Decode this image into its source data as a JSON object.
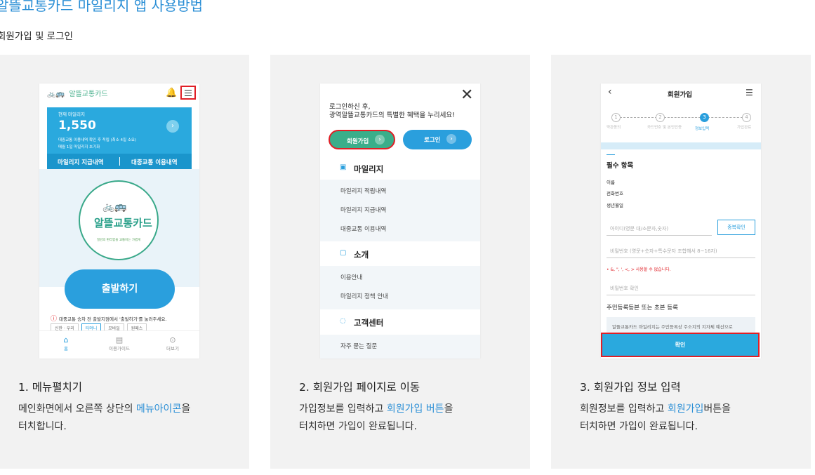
{
  "page": {
    "title": "알뜰교통카드 마일리지 앱 사용방법",
    "subtitle": "회원가입 및 로그인"
  },
  "steps": [
    {
      "title": "1. 메뉴펼치기",
      "desc_before": "메인화면에서 오른쪽 상단의 ",
      "desc_highlight": "메뉴아이콘",
      "desc_after": "을",
      "desc_line2": "터치합니다."
    },
    {
      "title": "2. 회원가입 페이지로 이동",
      "desc_before": "가입정보를 입력하고 ",
      "desc_highlight": "회원가입 버튼",
      "desc_after": "을",
      "desc_line2": "터치하면 가입이 완료됩니다."
    },
    {
      "title": "3. 회원가입 정보 입력",
      "desc_before": "회원정보를 입력하고 ",
      "desc_highlight": "회원가입",
      "desc_after": "버튼을",
      "desc_line2": "터치하면 가입이 완료됩니다."
    }
  ],
  "phone1": {
    "logo": "알뜰교통카드",
    "mileage_label": "현재 마일리지",
    "mileage_value": "1,550",
    "note1": "대중교통 이용내역 확인 후 적립 (최소 4일 소요)",
    "note2": "매월 1일 마일리지 초기화",
    "tab1": "마일리지 지급내역",
    "tab2": "대중교통 이용내역",
    "circle_text": "알뜰교통카드",
    "circle_sub": "절감의 편리함을 교통비는 가볍게",
    "start_button": "출발하기",
    "notice": "대중교통 승차 전 출발지점에서 '출발하기'를 눌러주세요.",
    "cards": [
      "신한 · 우리",
      "티머니",
      "모바일",
      "원패스"
    ],
    "nav": [
      "홈",
      "이용가이드",
      "더보기"
    ]
  },
  "phone2": {
    "message_line1": "로그인하신 후,",
    "message_line2": "광역알뜰교통카드의 특별한 혜택을 누리세요!",
    "join_button": "회원가입",
    "login_button": "로그인",
    "sections": [
      {
        "title": "마일리지",
        "items": [
          "마일리지 적립내역",
          "마일리지 지급내역",
          "대중교통 이용내역"
        ]
      },
      {
        "title": "소개",
        "items": [
          "이용안내",
          "마일리지 정책 안내"
        ]
      },
      {
        "title": "고객센터",
        "items": [
          "자주 묻는 질문"
        ]
      }
    ]
  },
  "phone3": {
    "title": "회원가입",
    "steps": [
      "약관동의",
      "카드번호 및 본인인증",
      "정보입력",
      "가입완료"
    ],
    "step_numbers": [
      "1",
      "2",
      "3",
      "4"
    ],
    "required": "필수 항목",
    "fields": [
      "이름",
      "전화번호",
      "생년월일"
    ],
    "id_placeholder": "아이디(영문 대/소문자,숫자)",
    "dup_button": "중복확인",
    "pw_placeholder": "비밀번호 (영문+숫자+특수문자 조합해서 8~16자)",
    "pw_warning": "• &, \", ', <, > 사용할 수 없습니다.",
    "pw_confirm_placeholder": "비밀번호 확인",
    "register_label": "주민등록등본 또는 초본 등록",
    "register_note": "알뜰교통카드 마일리지는 주민등록상 주소지의 지자체 예산으로",
    "confirm_button": "확인"
  }
}
